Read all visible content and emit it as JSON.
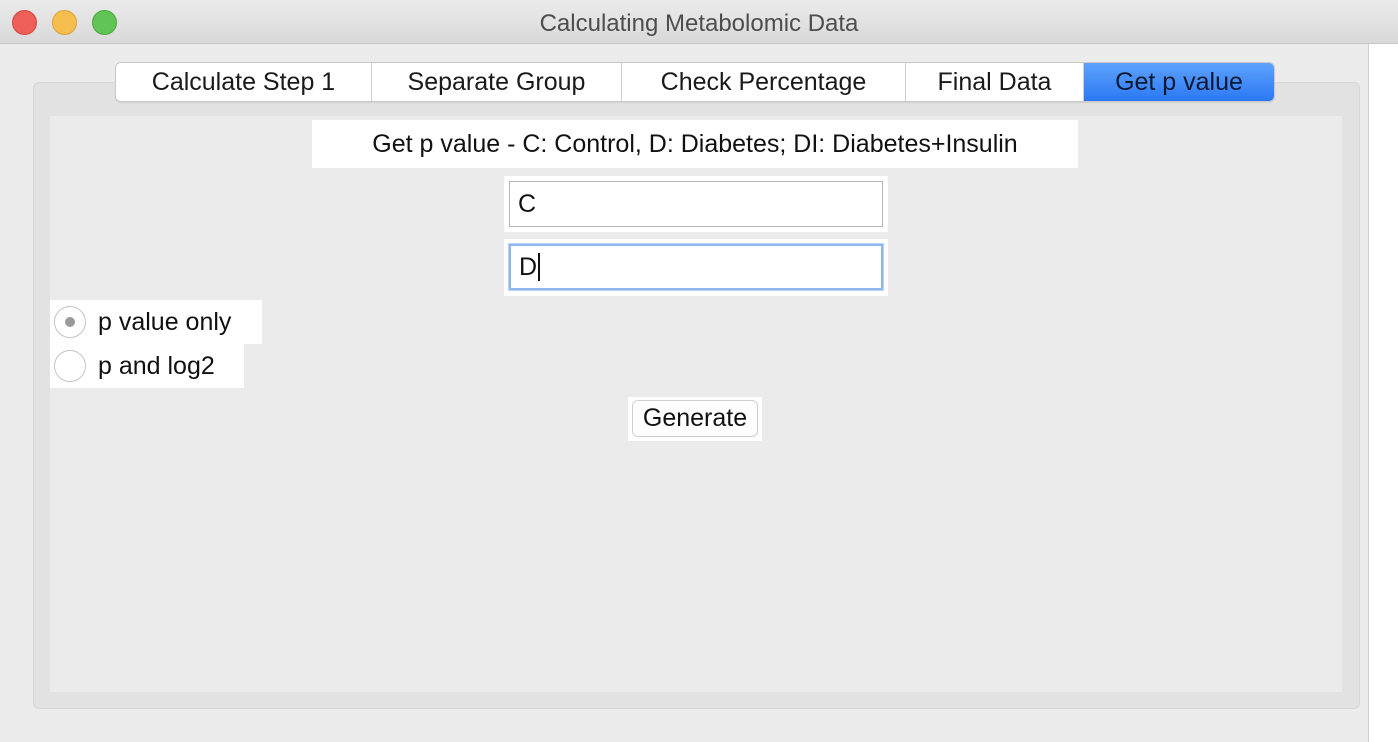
{
  "window": {
    "title": "Calculating Metabolomic Data"
  },
  "tabs": [
    {
      "label": "Calculate Step 1",
      "active": false
    },
    {
      "label": "Separate Group",
      "active": false
    },
    {
      "label": "Check Percentage",
      "active": false
    },
    {
      "label": "Final Data",
      "active": false
    },
    {
      "label": "Get p value",
      "active": true
    }
  ],
  "panel": {
    "heading": "Get p value - C: Control, D: Diabetes; DI: Diabetes+Insulin",
    "group1_value": "C",
    "group2_value": "D",
    "options": [
      {
        "label": "p value only",
        "selected": true
      },
      {
        "label": "p and log2",
        "selected": false
      }
    ],
    "generate_label": "Generate"
  },
  "colors": {
    "active_tab": "#2a78f4",
    "focus_ring": "#8fb7ee",
    "close": "#ee5f57",
    "minimize": "#f6be4f",
    "maximize": "#61c555"
  }
}
